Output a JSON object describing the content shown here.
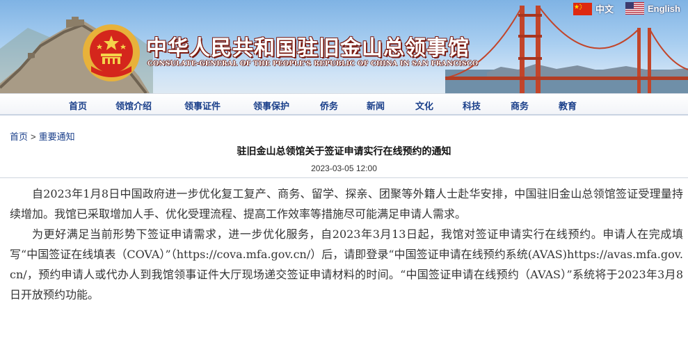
{
  "header": {
    "title_cn": "中华人民共和国驻旧金山总领事馆",
    "title_en": "CONSULATE-GENERAL OF THE PEOPLE'S REPUBLIC OF CHINA IN SAN FRANCISCO"
  },
  "languages": [
    {
      "label": "中文",
      "flag": "china-flag-icon"
    },
    {
      "label": "English",
      "flag": "usa-flag-icon"
    }
  ],
  "nav": [
    "首页",
    "领馆介绍",
    "领事证件",
    "领事保护",
    "侨务",
    "新闻",
    "文化",
    "科技",
    "商务",
    "教育"
  ],
  "breadcrumb": {
    "home": "首页",
    "separator": ">",
    "current": "重要通知"
  },
  "article": {
    "title": "驻旧金山总领馆关于签证申请实行在线预约的通知",
    "date": "2023-03-05 12:00",
    "paragraphs": [
      "自2023年1月8日中国政府进一步优化复工复产、商务、留学、探亲、团聚等外籍人士赴华安排，中国驻旧金山总领馆签证受理量持续增加。我馆已采取增加人手、优化受理流程、提高工作效率等措施尽可能满足申请人需求。",
      "为更好满足当前形势下签证申请需求，进一步优化服务，自2023年3月13日起，我馆对签证申请实行在线预约。申请人在完成填写“中国签证在线填表（COVA）”（https://cova.mfa.gov.cn/）后，请即登录“中国签证申请在线预约系统(AVAS)https://avas.mfa.gov.cn/，预约申请人或代办人到我馆领事证件大厅现场递交签证申请材料的时间。“中国签证申请在线预约（AVAS）”系统将于2023年3月8日开放预约功能。"
    ]
  },
  "colors": {
    "nav_text": "#1a3f8a",
    "title_shadow": "#7a1a10",
    "bridge": "#c2452a"
  }
}
